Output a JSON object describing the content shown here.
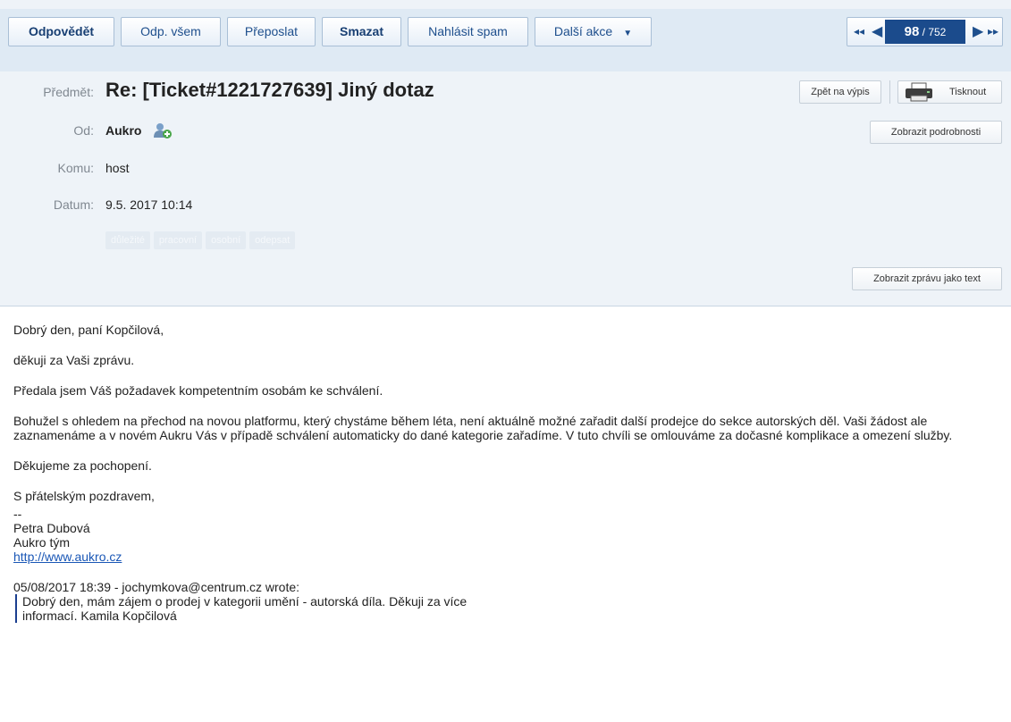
{
  "toolbar": {
    "reply": "Odpovědět",
    "reply_all": "Odp. všem",
    "forward": "Přeposlat",
    "delete": "Smazat",
    "report_spam": "Nahlásit spam",
    "more_actions": "Další akce",
    "pager": {
      "current": "98",
      "total": "/ 752"
    }
  },
  "header": {
    "subject_label": "Předmět:",
    "subject": "Re: [Ticket#1221727639] Jiný dotaz",
    "from_label": "Od:",
    "from": "Aukro",
    "to_label": "Komu:",
    "to": "host",
    "date_label": "Datum:",
    "date": "9.5. 2017 10:14",
    "tags": [
      "důležité",
      "pracovní",
      "osobní",
      "odepsat"
    ],
    "back_to_list": "Zpět na výpis",
    "print": "Tisknout",
    "show_details": "Zobrazit podrobnosti",
    "show_as_text": "Zobrazit zprávu jako text"
  },
  "body": {
    "greeting": "Dobrý den, paní Kopčilová,",
    "p1": "děkuji za Vaši zprávu.",
    "p2": "Předala jsem Váš požadavek kompetentním osobám ke schválení.",
    "p3": "Bohužel s ohledem na přechod na novou platformu, který chystáme během léta, není aktuálně možné zařadit další prodejce do sekce autorských děl. Vaši žádost ale zaznamenáme a v novém Aukru Vás v případě schválení automaticky do dané kategorie zařadíme. V tuto chvíli se omlouváme za dočasné komplikace a omezení služby.",
    "p4": "Děkujeme za pochopení.",
    "closing": "S přátelským pozdravem,",
    "sig_sep": "--",
    "sig_name": "Petra Dubová",
    "sig_team": "Aukro tým",
    "sig_link": "http://www.aukro.cz",
    "quote_header": "05/08/2017 18:39 - jochymkova@centrum.cz wrote:",
    "quote_line1": "Dobrý den, mám zájem o prodej v kategorii umění - autorská díla. Děkuji za více",
    "quote_line2": "informací. Kamila Kopčilová"
  }
}
